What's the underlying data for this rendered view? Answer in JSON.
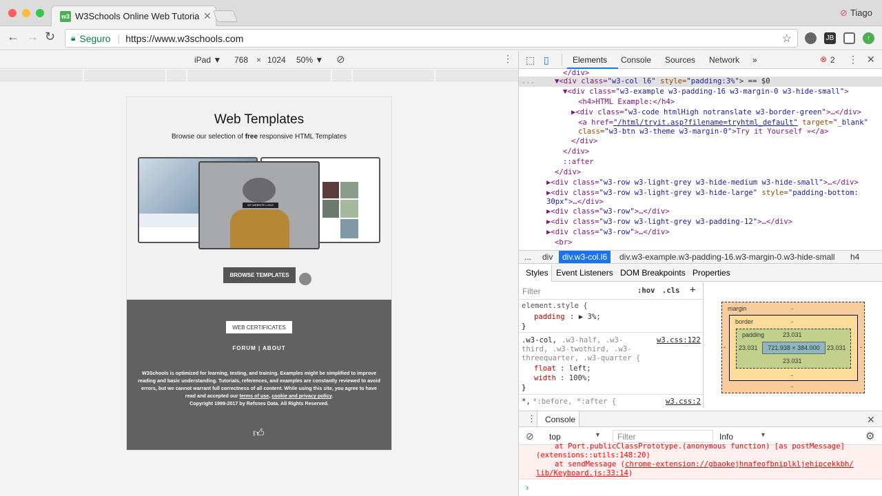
{
  "browser": {
    "tab_title": "W3Schools Online Web Tutorials",
    "tab_favicon": "w3",
    "user_name": "Tiago",
    "url_secure_label": "Seguro",
    "url": "https://www.w3schools.com",
    "ext_badge": "JB"
  },
  "device_bar": {
    "device": "iPad ▼",
    "width": "768",
    "times": "×",
    "height": "1024",
    "zoom": "50% ▼"
  },
  "page": {
    "heading": "Web Templates",
    "subtitle_pre": "Browse our selection of ",
    "subtitle_bold": "free",
    "subtitle_post": " responsive HTML Templates",
    "template_caption": "MY WEBSITE LOGO",
    "browse_button": "BROWSE TEMPLATES",
    "cert_button": "WEB CERTIFICATES",
    "forum_about": "FORUM | ABOUT",
    "legal_1": "W3Schools is optimized for learning, testing, and training. Examples might be simplified to improve reading and basic understanding. Tutorials, references, and examples are constantly reviewed to avoid errors, but we cannot warrant full correctness of all content. While using this site, you agree to have read and accepted our ",
    "legal_link1": "terms of use",
    "legal_comma": ", ",
    "legal_link2": "cookie and privacy policy",
    "legal_end": ".",
    "copyright": "Copyright 1999-2017 by Refsnes Data. All Rights Reserved."
  },
  "devtools": {
    "tabs": [
      "Elements",
      "Console",
      "Sources",
      "Network",
      "»"
    ],
    "error_count": "2",
    "dom_lines": [
      {
        "t": "</div>"
      },
      {
        "pre": "▼<div class=",
        "v1": "\"w3-col l6\"",
        "mid": " style=",
        "v2": "\"padding:3%\"",
        "post": "> == $0"
      },
      {
        "pre": "▼<div class=",
        "v1": "\"w3-example w3-padding-16 w3-margin-0 w3-hide-small\"",
        "post": ">"
      },
      {
        "t": "<h4>HTML Example:</h4>"
      },
      {
        "pre": "▶<div class=",
        "v1": "\"w3-code htmlHigh notranslate w3-border-green\"",
        "post": ">…</div>"
      },
      {
        "pre": "<a href=",
        "v1": "\"/html/tryit.asp?filename=tryhtml_default\"",
        "mid": " target=",
        "v2": "\"_blank\""
      },
      {
        "pre": "class=",
        "v1": "\"w3-btn w3-theme w3-margin-0\"",
        "post": ">Try it Yourself »</a>"
      },
      {
        "t": "</div>"
      },
      {
        "t": "</div>"
      },
      {
        "t": "::after"
      },
      {
        "t": "</div>"
      },
      {
        "pre": "▶<div class=",
        "v1": "\"w3-row w3-light-grey w3-hide-medium w3-hide-small\"",
        "post": ">…</div>"
      },
      {
        "pre": "▶<div class=",
        "v1": "\"w3-row w3-light-grey w3-hide-large\"",
        "mid": " style=",
        "v2": "\"padding-bottom:"
      },
      {
        "pre": "",
        "v1": "30px\"",
        "post": ">…</div>"
      },
      {
        "pre": "▶<div class=",
        "v1": "\"w3-row\"",
        "post": ">…</div>"
      },
      {
        "pre": "▶<div class=",
        "v1": "\"w3-row w3-light-grey w3-padding-12\"",
        "post": ">…</div>"
      },
      {
        "pre": "▶<div class=",
        "v1": "\"w3-row\"",
        "post": ">…</div>"
      },
      {
        "t": "<br>"
      }
    ],
    "crumbs": [
      "...",
      "div",
      "div.w3-col.l6",
      "div.w3-example.w3-padding-16.w3-margin-0.w3-hide-small",
      "h4"
    ],
    "subtabs": [
      "Styles",
      "Event Listeners",
      "DOM Breakpoints",
      "Properties"
    ],
    "styles_filter": "Filter",
    "hov": ":hov",
    "cls": ".cls",
    "rule1_selector": "element.style {",
    "rule1_prop": "padding",
    "rule1_val": "3%;",
    "rule2_selector_a": ".w3-col,",
    "rule2_selector_b": " .w3-half, .w3-",
    "rule2_selector_c": "third, .w3-twothird, .w3-",
    "rule2_selector_d": "threequarter, .w3-quarter {",
    "rule2_source": "w3.css:122",
    "rule2_p1": "float",
    "rule2_v1": "left;",
    "rule2_p2": "width",
    "rule2_v2": "100%;",
    "rule3_selector_a": "*,",
    "rule3_selector_b": " *:before, *:after {",
    "rule3_source": "w3.css:2",
    "close_brace": "}",
    "box": {
      "margin_label": "margin",
      "border_label": "border",
      "padding_label": "padding",
      "dash": "-",
      "padding_value": "23.031",
      "content": "721.938 × 384.000"
    },
    "console_label": "Console",
    "console_context": "top",
    "console_filter": "Filter",
    "console_level": "Info",
    "error_line1": "at Port.publicClassPrototype.(anonymous function) [as postMessage]",
    "error_line2": "(extensions::utils:148:20)",
    "error_line3": "at sendMessage (",
    "error_link": "chrome-extension://gbaokejhnafeofbniplkljehipcekkbh/",
    "error_link2": "lib/Keyboard.js:33:14",
    "error_close": ")",
    "prompt": "›"
  }
}
